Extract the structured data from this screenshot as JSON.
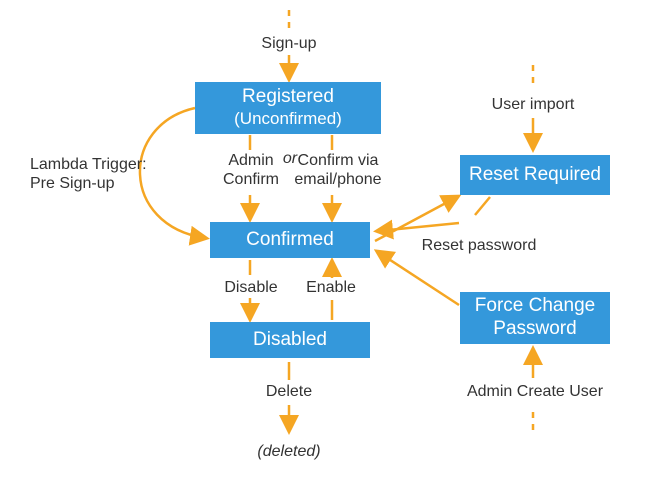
{
  "diagram": {
    "type": "state-transition",
    "states": {
      "registered": {
        "title": "Registered",
        "subtitle": "(Unconfirmed)"
      },
      "confirmed": "Confirmed",
      "disabled": "Disabled",
      "reset_required": "Reset Required",
      "force_change_password": "Force Change\nPassword",
      "deleted": "(deleted)"
    },
    "transitions": {
      "signup": "Sign-up",
      "admin_confirm": "Admin\nConfirm",
      "confirm_via": "Confirm via\nemail/phone",
      "or": "or",
      "lambda_trigger": "Lambda Trigger:\nPre Sign-up",
      "disable": "Disable",
      "enable": "Enable",
      "delete": "Delete",
      "user_import": "User import",
      "reset_password": "Reset password",
      "admin_create_user": "Admin Create User"
    },
    "colors": {
      "state_fill": "#3498db",
      "arrow": "#f5a623",
      "text": "#333333"
    }
  }
}
